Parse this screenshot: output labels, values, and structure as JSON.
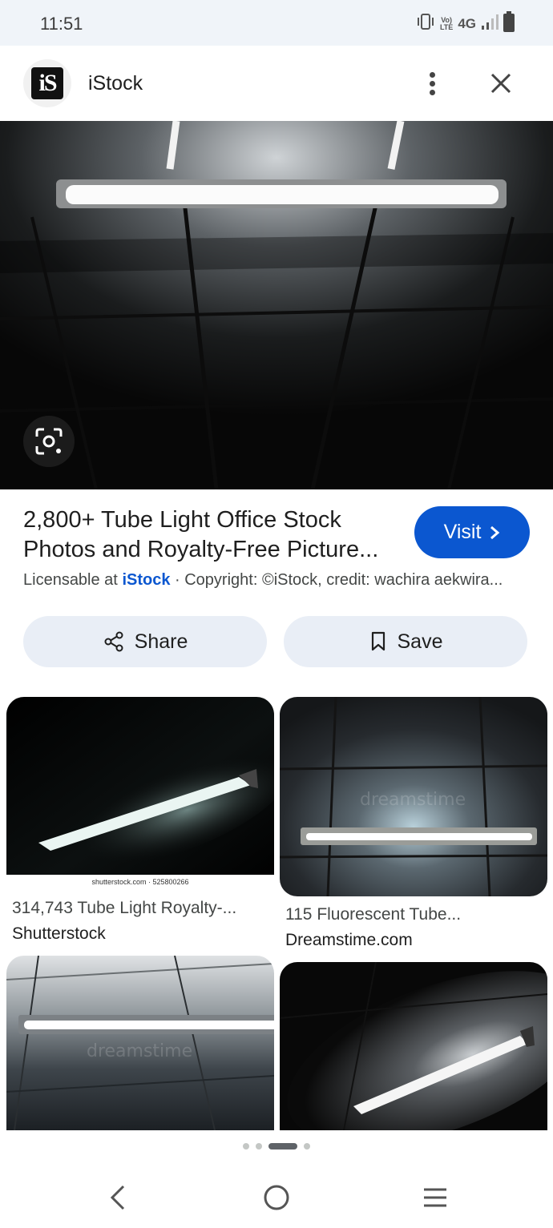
{
  "status_bar": {
    "time": "11:51",
    "network": "4G",
    "lte_top": "Vo)",
    "lte_bottom": "LTE",
    "icons": [
      "vibrate-icon",
      "volte-icon",
      "signal-icon",
      "battery-icon"
    ]
  },
  "header": {
    "logo_text": "iS",
    "title": "iStock",
    "icons": [
      "more-vert-icon",
      "close-icon"
    ]
  },
  "result": {
    "title_line1": "2,800+ Tube Light Office Stock",
    "title_line2": "Photos and Royalty-Free Picture...",
    "visit_label": "Visit",
    "license_prefix": "Licensable at",
    "license_brand": "iStock",
    "license_rest": " · Copyright: ©iStock, credit: wachira aekwira..."
  },
  "actions": {
    "share_label": "Share",
    "save_label": "Save"
  },
  "related": [
    {
      "caption": "314,743 Tube Light Royalty-...",
      "source": "Shutterstock",
      "strip": "shutterstock.com · 525800266"
    },
    {
      "caption": "115 Fluorescent Tube...",
      "source": "Dreamstime.com",
      "watermark": "dreamstime"
    },
    {
      "watermark": "dreamstime"
    },
    {}
  ],
  "pagination": {
    "count": 4,
    "active_index": 2
  },
  "colors": {
    "accent": "#0b57d0",
    "button_bg": "#e9eef6",
    "status_bg": "#f0f4f9"
  }
}
